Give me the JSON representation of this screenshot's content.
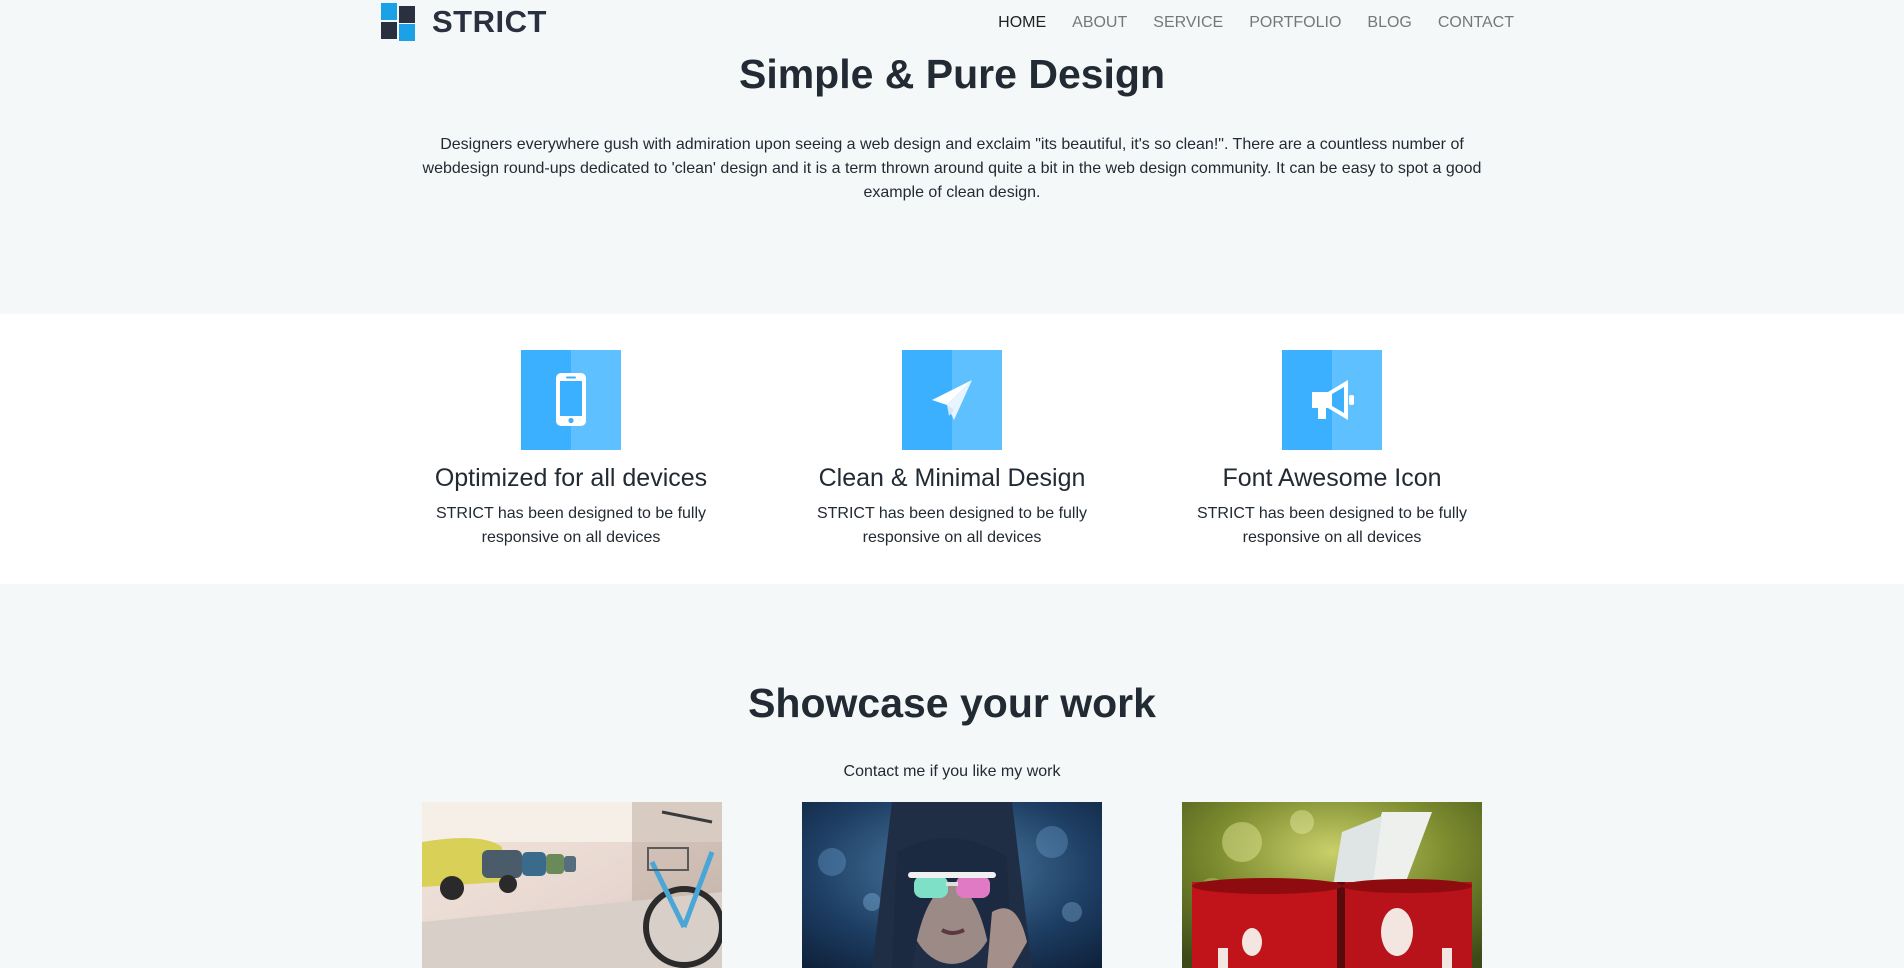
{
  "brand": {
    "name": "STRICT",
    "logo_icon": "four-squares-logo-icon",
    "accent_color": "#1aa1e6",
    "dark_color": "#2b3040"
  },
  "nav": {
    "items": [
      {
        "label": "HOME",
        "active": true
      },
      {
        "label": "ABOUT",
        "active": false
      },
      {
        "label": "SERVICE",
        "active": false
      },
      {
        "label": "PORTFOLIO",
        "active": false
      },
      {
        "label": "BLOG",
        "active": false
      },
      {
        "label": "CONTACT",
        "active": false
      }
    ]
  },
  "hero": {
    "title": "Simple & Pure Design",
    "text": "Designers everywhere gush with admiration upon seeing a web design and exclaim \"its beautiful, it's so clean!\". There are a countless number of webdesign round-ups dedicated to 'clean' design and it is a term thrown around quite a bit in the web design community. It can be easy to spot a good example of clean design."
  },
  "features": {
    "icon_color": "#3bb0ff",
    "items": [
      {
        "icon": "mobile-phone-icon",
        "title": "Optimized for all devices",
        "text": "STRICT has been designed to be fully responsive on all devices"
      },
      {
        "icon": "paper-plane-icon",
        "title": "Clean & Minimal Design",
        "text": "STRICT has been designed to be fully responsive on all devices"
      },
      {
        "icon": "bullhorn-icon",
        "title": "Font Awesome Icon",
        "text": "STRICT has been designed to be fully responsive on all devices"
      }
    ]
  },
  "showcase": {
    "title": "Showcase your work",
    "subtitle": "Contact me if you like my work",
    "items": [
      {
        "subject": "street-bicycle-photo"
      },
      {
        "subject": "woman-sunglasses-photo"
      },
      {
        "subject": "red-mugs-photo"
      }
    ]
  }
}
